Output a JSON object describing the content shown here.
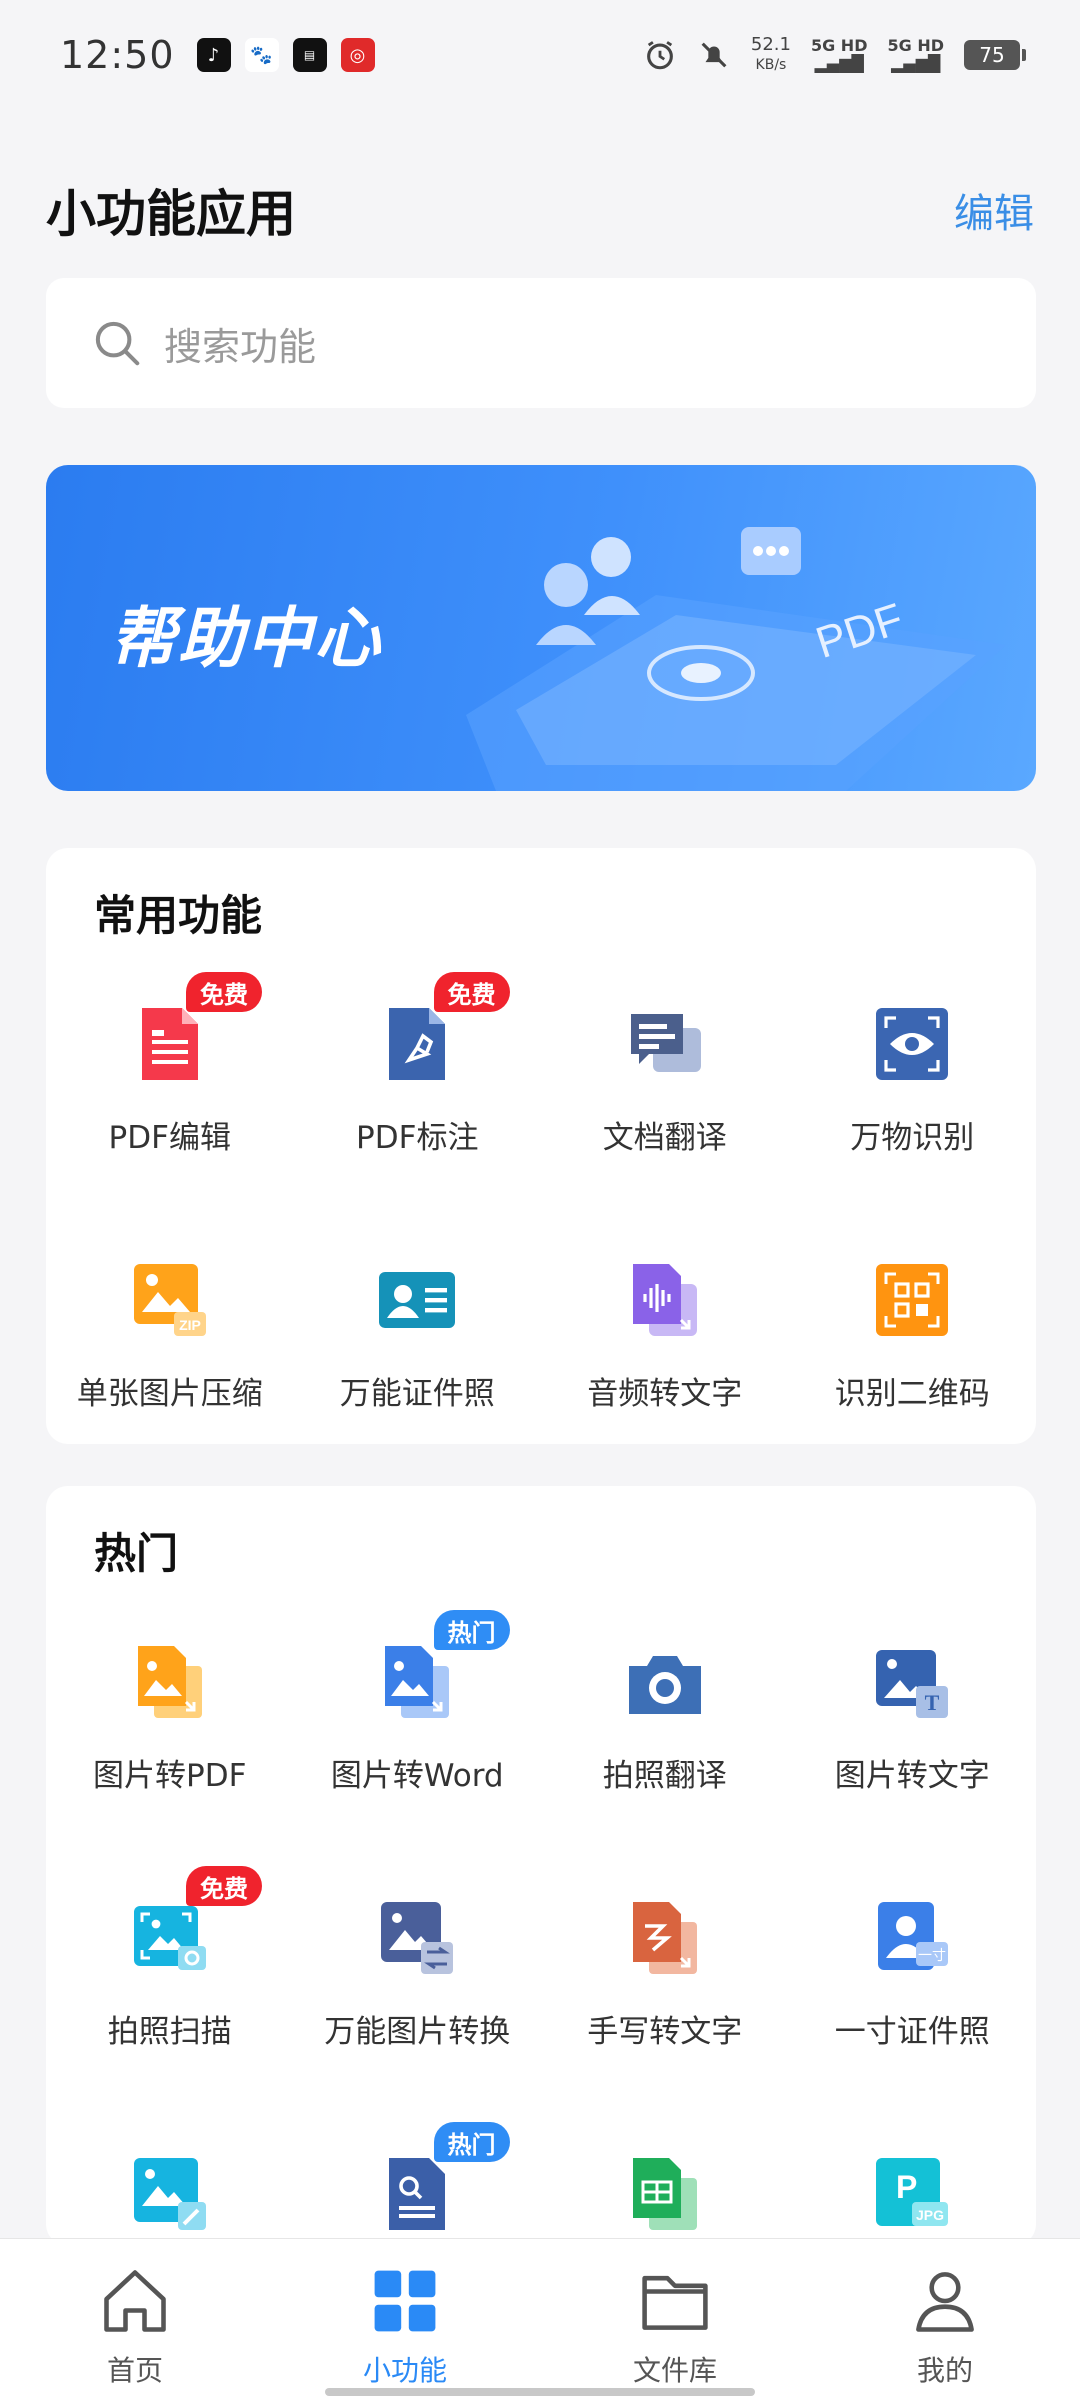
{
  "status_bar": {
    "time": "12:50",
    "apps": [
      "douyin-icon",
      "baidu-icon",
      "news-icon",
      "netease-music-icon"
    ],
    "speed_value": "52.1",
    "speed_unit": "KB/s",
    "network1": "5G HD",
    "network2": "5G HD",
    "battery": "75"
  },
  "header": {
    "title": "小功能应用",
    "edit_label": "编辑"
  },
  "search": {
    "placeholder": "搜索功能"
  },
  "banner": {
    "title": "帮助中心",
    "pdf_text": "PDF"
  },
  "common_section": {
    "title": "常用功能",
    "items": [
      {
        "label": "PDF编辑",
        "icon": "pdf-edit-icon",
        "badge": "免费",
        "badge_color": "#f0232d"
      },
      {
        "label": "PDF标注",
        "icon": "pdf-annotate-icon",
        "badge": "免费",
        "badge_color": "#f0232d"
      },
      {
        "label": "文档翻译",
        "icon": "doc-translate-icon",
        "badge": ""
      },
      {
        "label": "万物识别",
        "icon": "object-recognition-icon",
        "badge": ""
      },
      {
        "label": "单张图片压缩",
        "icon": "image-compress-icon",
        "badge": ""
      },
      {
        "label": "万能证件照",
        "icon": "id-photo-icon",
        "badge": ""
      },
      {
        "label": "音频转文字",
        "icon": "audio-to-text-icon",
        "badge": ""
      },
      {
        "label": "识别二维码",
        "icon": "qr-scan-icon",
        "badge": ""
      }
    ]
  },
  "hot_section": {
    "title": "热门",
    "items": [
      {
        "label": "图片转PDF",
        "icon": "image-to-pdf-icon",
        "badge": ""
      },
      {
        "label": "图片转Word",
        "icon": "image-to-word-icon",
        "badge": "热门",
        "badge_color": "#2f8df5"
      },
      {
        "label": "拍照翻译",
        "icon": "camera-translate-icon",
        "badge": ""
      },
      {
        "label": "图片转文字",
        "icon": "image-to-text-icon",
        "badge": ""
      },
      {
        "label": "拍照扫描",
        "icon": "camera-scan-icon",
        "badge": "免费",
        "badge_color": "#f0232d"
      },
      {
        "label": "万能图片转换",
        "icon": "image-convert-icon",
        "badge": ""
      },
      {
        "label": "手写转文字",
        "icon": "handwriting-to-text-icon",
        "badge": ""
      },
      {
        "label": "一寸证件照",
        "icon": "one-inch-photo-icon",
        "badge": ""
      },
      {
        "label": "",
        "icon": "image-repair-icon",
        "badge": ""
      },
      {
        "label": "",
        "icon": "doc-search-icon",
        "badge": "热门",
        "badge_color": "#2f8df5"
      },
      {
        "label": "",
        "icon": "sheet-convert-icon",
        "badge": ""
      },
      {
        "label": "",
        "icon": "ppt-to-jpg-icon",
        "badge": ""
      }
    ]
  },
  "one_inch_text": "一寸",
  "jpg_text": "JPG",
  "zip_text": "ZIP",
  "bottom_nav": {
    "items": [
      {
        "label": "首页",
        "icon": "home-icon",
        "active": false
      },
      {
        "label": "小功能",
        "icon": "grid-apps-icon",
        "active": true
      },
      {
        "label": "文件库",
        "icon": "folder-icon",
        "active": false
      },
      {
        "label": "我的",
        "icon": "profile-icon",
        "active": false
      }
    ]
  },
  "colors": {
    "accent": "#2a8af6",
    "edit": "#3a8ee6",
    "badge_red": "#f0232d",
    "badge_blue": "#2f8df5"
  }
}
